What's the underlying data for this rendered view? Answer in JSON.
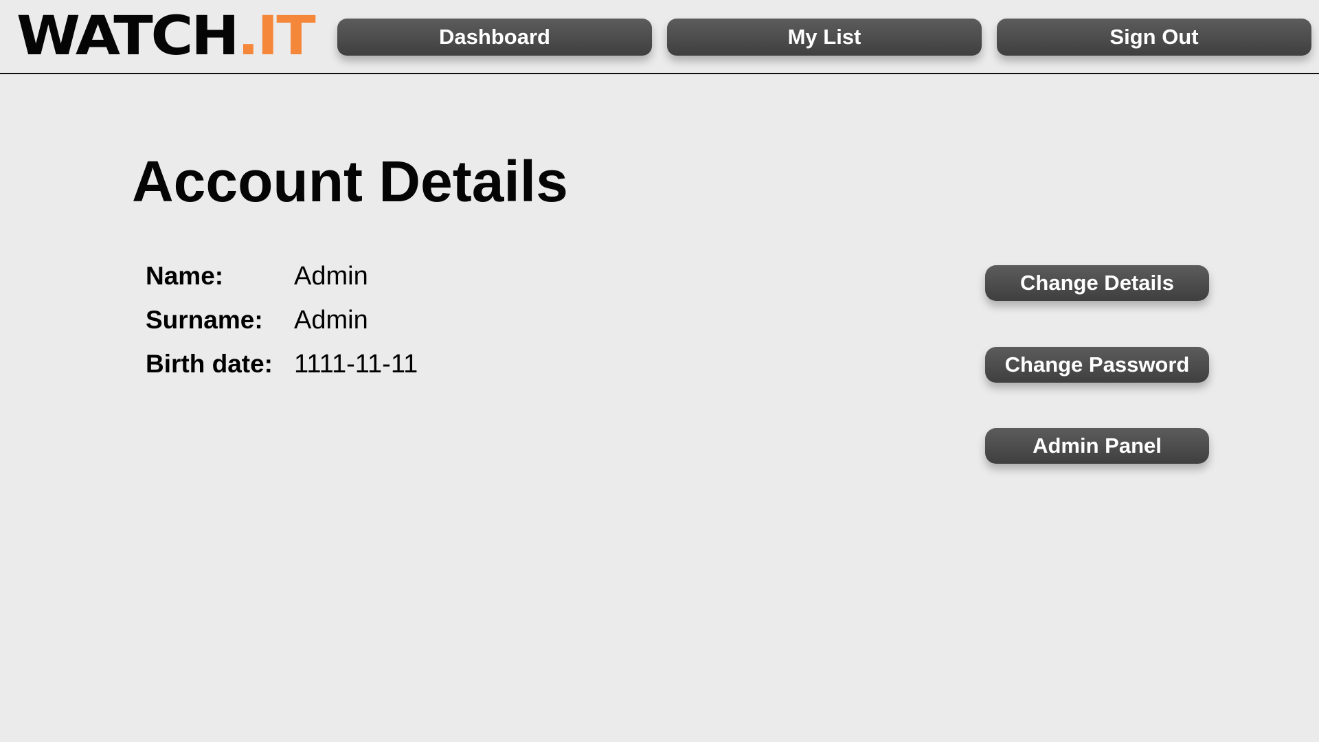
{
  "header": {
    "logo": {
      "main": "WATCH",
      "accent": ".IT",
      "accent_color": "#f5873a"
    },
    "nav": {
      "dashboard": "Dashboard",
      "my_list": "My List",
      "sign_out": "Sign Out"
    }
  },
  "main": {
    "title": "Account Details",
    "details": [
      {
        "label": "Name:",
        "value": "Admin"
      },
      {
        "label": "Surname:",
        "value": "Admin"
      },
      {
        "label": "Birth date:",
        "value": "1111-11-11"
      }
    ],
    "actions": {
      "change_details": "Change Details",
      "change_password": "Change Password",
      "admin_panel": "Admin Panel"
    }
  },
  "colors": {
    "background": "#ebebeb",
    "button": "#4a4a4a",
    "button_text": "#ffffff"
  }
}
